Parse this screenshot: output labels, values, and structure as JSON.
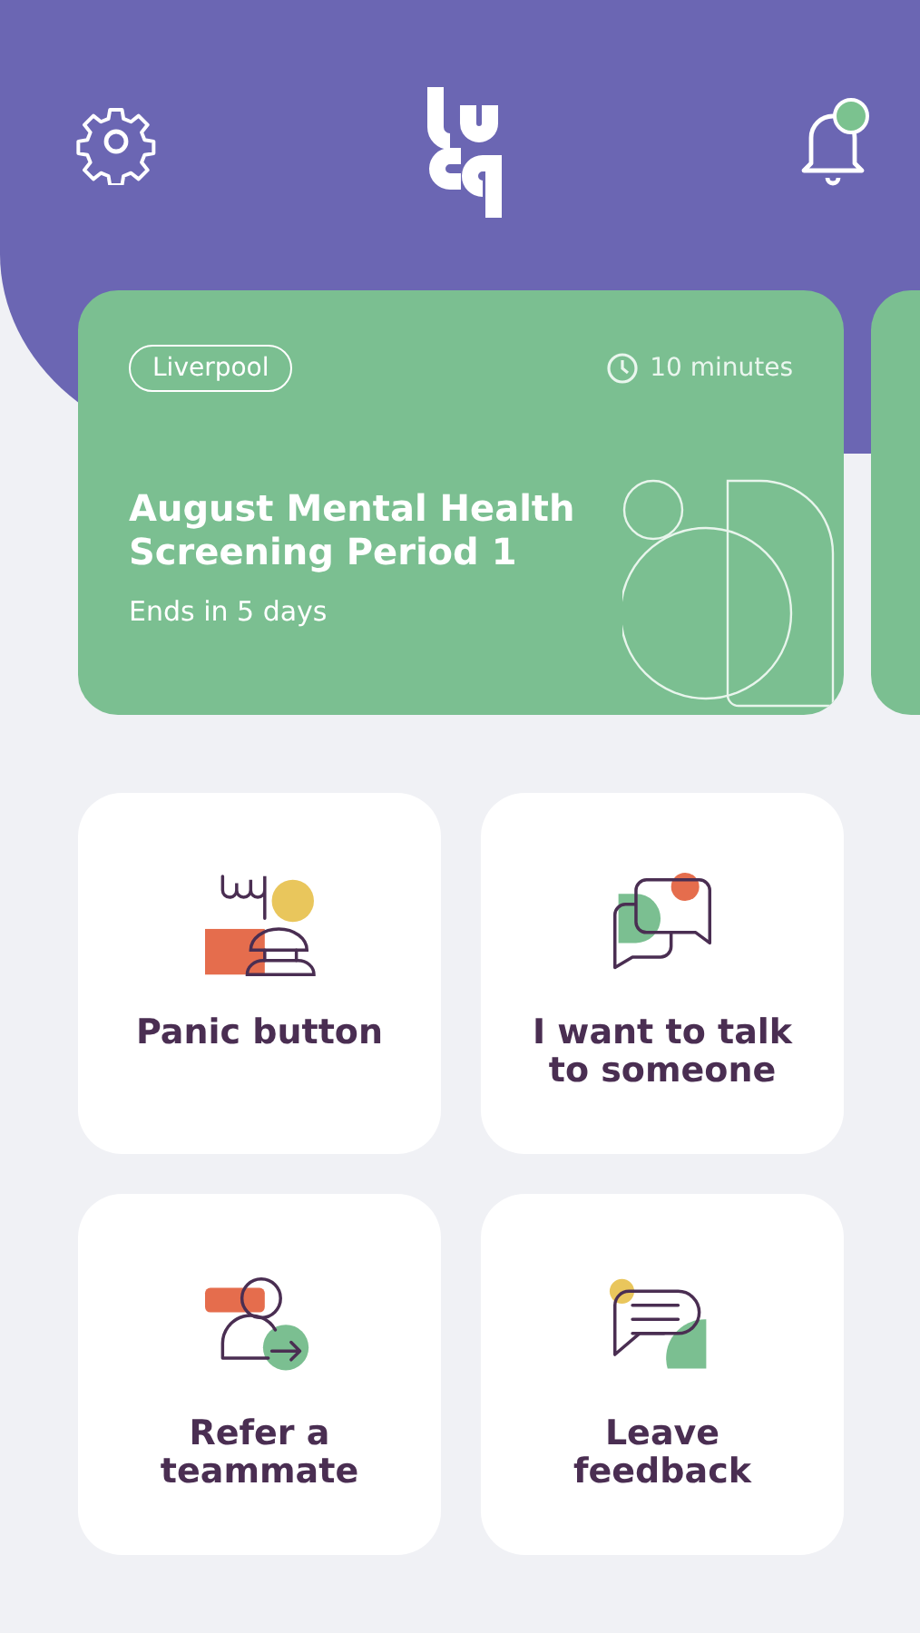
{
  "header": {
    "notification_unread": true
  },
  "survey_cards": [
    {
      "kind": "survey",
      "location": "Liverpool",
      "duration": "10 minutes",
      "title": "August Mental Health Screening Period 1",
      "ends": "Ends in 5 days"
    },
    {
      "kind": "peek"
    }
  ],
  "actions": [
    {
      "kind": "panic",
      "label": "Panic button"
    },
    {
      "kind": "talk",
      "label": "I want to talk to someone"
    },
    {
      "kind": "refer",
      "label": "Refer a teammate"
    },
    {
      "kind": "feedback",
      "label": "Leave feedback"
    }
  ]
}
